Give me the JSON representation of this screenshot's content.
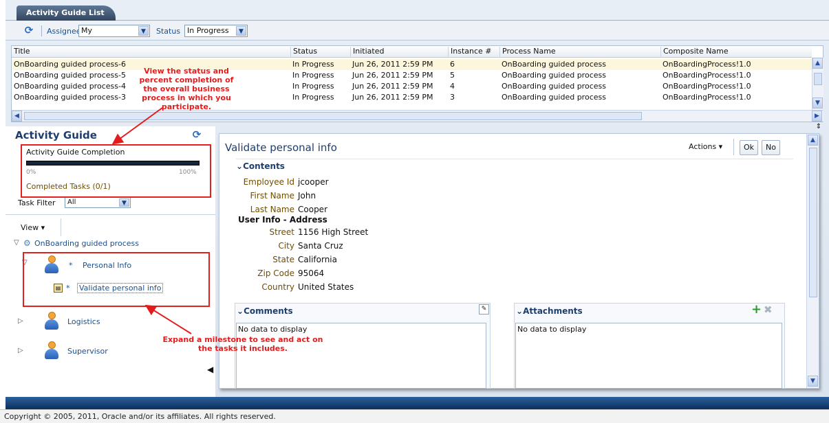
{
  "header": {
    "tab_label": "Activity Guide List"
  },
  "toolbar": {
    "assignee_label": "Assignee",
    "assignee_value": "My",
    "status_label": "Status",
    "status_value": "In Progress"
  },
  "table": {
    "columns": [
      "Title",
      "Status",
      "Initiated",
      "Instance #",
      "Process Name",
      "Composite Name"
    ],
    "rows": [
      [
        "OnBoarding guided process-6",
        "In Progress",
        "Jun 26, 2011 2:59 PM",
        "6",
        "OnBoarding guided process",
        "OnBoardingProcess!1.0"
      ],
      [
        "OnBoarding guided process-5",
        "In Progress",
        "Jun 26, 2011 2:59 PM",
        "5",
        "OnBoarding guided process",
        "OnBoardingProcess!1.0"
      ],
      [
        "OnBoarding guided process-4",
        "In Progress",
        "Jun 26, 2011 2:59 PM",
        "4",
        "OnBoarding guided process",
        "OnBoardingProcess!1.0"
      ],
      [
        "OnBoarding guided process-3",
        "In Progress",
        "Jun 26, 2011 2:59 PM",
        "3",
        "OnBoarding guided process",
        "OnBoardingProcess!1.0"
      ]
    ]
  },
  "activity_guide": {
    "title": "Activity Guide",
    "completion_label": "Activity Guide Completion",
    "progress_min": "0%",
    "progress_max": "100%",
    "progress_fraction": 0,
    "completed_tasks": "Completed Tasks  (0/1)",
    "task_filter_label": "Task Filter",
    "task_filter_value": "All",
    "view_label": "View",
    "tree": {
      "process": "OnBoarding guided process",
      "milestones": [
        {
          "label": "Personal Info",
          "expanded": true,
          "tasks": [
            "Validate personal info"
          ]
        },
        {
          "label": "Logistics",
          "expanded": false
        },
        {
          "label": "Supervisor",
          "expanded": false
        }
      ]
    }
  },
  "task": {
    "title": "Validate personal info",
    "actions_label": "Actions",
    "ok_label": "Ok",
    "no_label": "No",
    "contents_label": "Contents",
    "fields": [
      {
        "label": "Employee Id",
        "value": "jcooper"
      },
      {
        "label": "First Name",
        "value": "John"
      },
      {
        "label": "Last Name",
        "value": "Cooper"
      }
    ],
    "address_heading": "User Info - Address",
    "address_fields": [
      {
        "label": "Street",
        "value": "1156 High Street"
      },
      {
        "label": "City",
        "value": "Santa Cruz"
      },
      {
        "label": "State",
        "value": "California"
      },
      {
        "label": "Zip Code",
        "value": "95064"
      },
      {
        "label": "Country",
        "value": "United States"
      }
    ],
    "comments_label": "Comments",
    "comments_empty": "No data to display",
    "attachments_label": "Attachments",
    "attachments_empty": "No data to display"
  },
  "annotations": {
    "status_note": "View the status and percent completion of the overall business process in which you participate.",
    "milestone_note": "Expand a milestone to see and act on the tasks it includes."
  },
  "footer": {
    "copyright": "Copyright © 2005, 2011, Oracle and/or its affiliates. All rights reserved."
  },
  "colors": {
    "annotation_red": "#e51b1b",
    "brand_blue": "#1c4f8c",
    "field_label": "#6f4e00"
  }
}
